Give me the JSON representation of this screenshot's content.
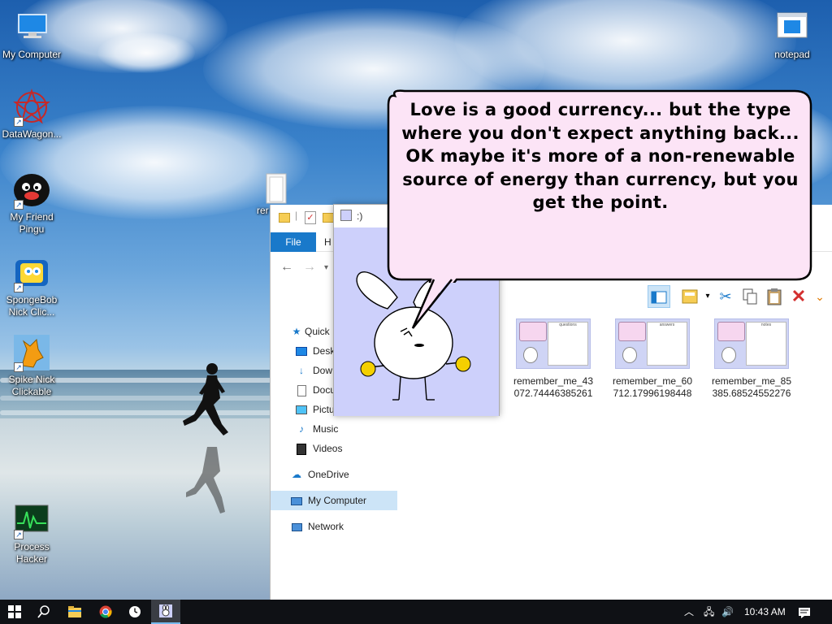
{
  "desktop": {
    "icons": [
      {
        "label": "My Computer",
        "icon": "computer-icon"
      },
      {
        "label": "DataWagon...",
        "icon": "datawagon-icon"
      },
      {
        "label": "My Friend Pingu",
        "icon": "pingu-icon"
      },
      {
        "label": "SpongeBob Nick Clic...",
        "icon": "spongebob-icon"
      },
      {
        "label": "Spike Nick Clickable",
        "icon": "spike-icon"
      },
      {
        "label": "Process Hacker",
        "icon": "process-hacker-icon"
      },
      {
        "label": "notepad",
        "icon": "notepad-icon"
      },
      {
        "label": "rer",
        "icon": "folder-icon"
      }
    ]
  },
  "explorer": {
    "file_tab": "File",
    "home_tab": "H",
    "nav": {
      "quick_access": "Quick",
      "desktop": "Desk",
      "downloads": "Dow",
      "documents": "Docu",
      "pictures": "Pictu",
      "music": "Music",
      "videos": "Videos",
      "onedrive": "OneDrive",
      "my_computer": "My Computer",
      "network": "Network"
    },
    "files": [
      {
        "name": "remember_me_43072.74446385261"
      },
      {
        "name": "remember_me_60712.17996198448"
      },
      {
        "name": "remember_me_85385.68524552276"
      }
    ]
  },
  "popup": {
    "title": ":)"
  },
  "bubble": {
    "text": "Love is a good currency... but the type where you don't expect anything back... OK maybe it's more of a non-renewable source of energy than currency, but you get the point."
  },
  "taskbar": {
    "time": "10:43 AM"
  },
  "colors": {
    "accent": "#1979ca",
    "bubble_fill": "#fce4f6",
    "popup_bg": "#cdd0fb",
    "taskbar": "#0f1115"
  }
}
